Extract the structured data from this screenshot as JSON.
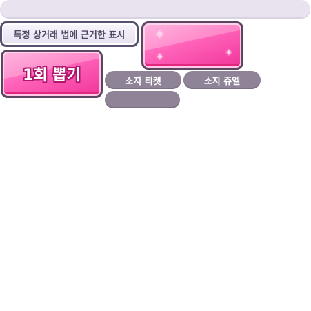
{
  "legal_notice": {
    "label": "특정 상거래 법에 근거한 표시"
  },
  "draw_button": {
    "label": "1회 뽑기"
  },
  "currency": {
    "tickets_label": "소지 티켓",
    "jewels_label": "소지 쥬엘",
    "third_label": ""
  },
  "colors": {
    "accent_pink": "#ff63b9",
    "pill_gray": "#8f8497",
    "outline": "#57506e"
  },
  "icons": {
    "sparkle": "sparkle-icon"
  }
}
